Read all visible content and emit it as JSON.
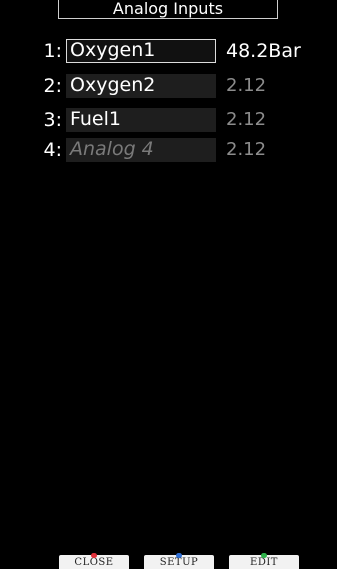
{
  "title": "Analog Inputs",
  "inputs": [
    {
      "index": "1:",
      "name": "Oxygen1",
      "value": "48.2Bar"
    },
    {
      "index": "2:",
      "name": "Oxygen2",
      "value": "2.12"
    },
    {
      "index": "3:",
      "name": "Fuel1",
      "value": "2.12"
    },
    {
      "index": "4:",
      "name": "Analog 4",
      "value": "2.12"
    }
  ],
  "buttons": {
    "close": {
      "label": "CLOSE",
      "color": "#e0303a"
    },
    "setup": {
      "label": "SETUP",
      "color": "#2f6fd6"
    },
    "edit": {
      "label": "EDIT",
      "color": "#2fb34a"
    }
  },
  "colors": {
    "background": "#000000",
    "text": "#ffffff",
    "dimmed_value": "#8c8c8c",
    "field_background": "#1e1e1e"
  }
}
